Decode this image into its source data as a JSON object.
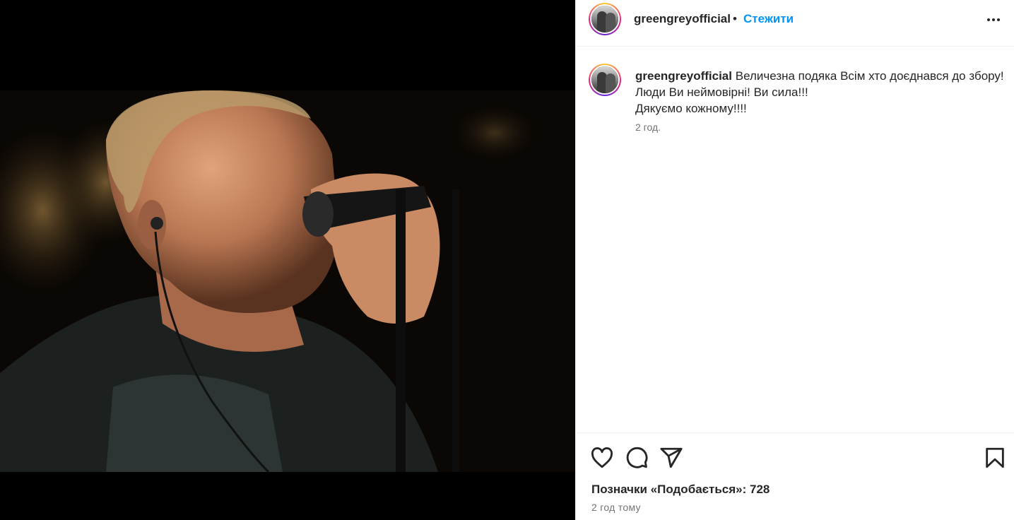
{
  "post": {
    "image_alt_subject": "singer-with-microphone-photo"
  },
  "header": {
    "username": "greengreyofficial",
    "separator": "•",
    "follow_label": "Стежити",
    "more_icon": "more-horizontal-icon"
  },
  "caption": {
    "username": "greengreyofficial",
    "line1": "Величезна подяка Всім хто доєднався до збору!",
    "line2": "Люди Ви неймовірні! Ви сила!!!",
    "line3": "Дякуємо кожному!!!!",
    "time": "2 год."
  },
  "actions": {
    "like_icon": "heart-icon",
    "comment_icon": "comment-icon",
    "share_icon": "send-icon",
    "save_icon": "bookmark-icon"
  },
  "stats": {
    "likes_text": "Позначки «Подобається»: 728",
    "posted_ago": "2 год тому"
  },
  "colors": {
    "link": "#0095f6",
    "text": "#262626",
    "muted": "#737373"
  }
}
